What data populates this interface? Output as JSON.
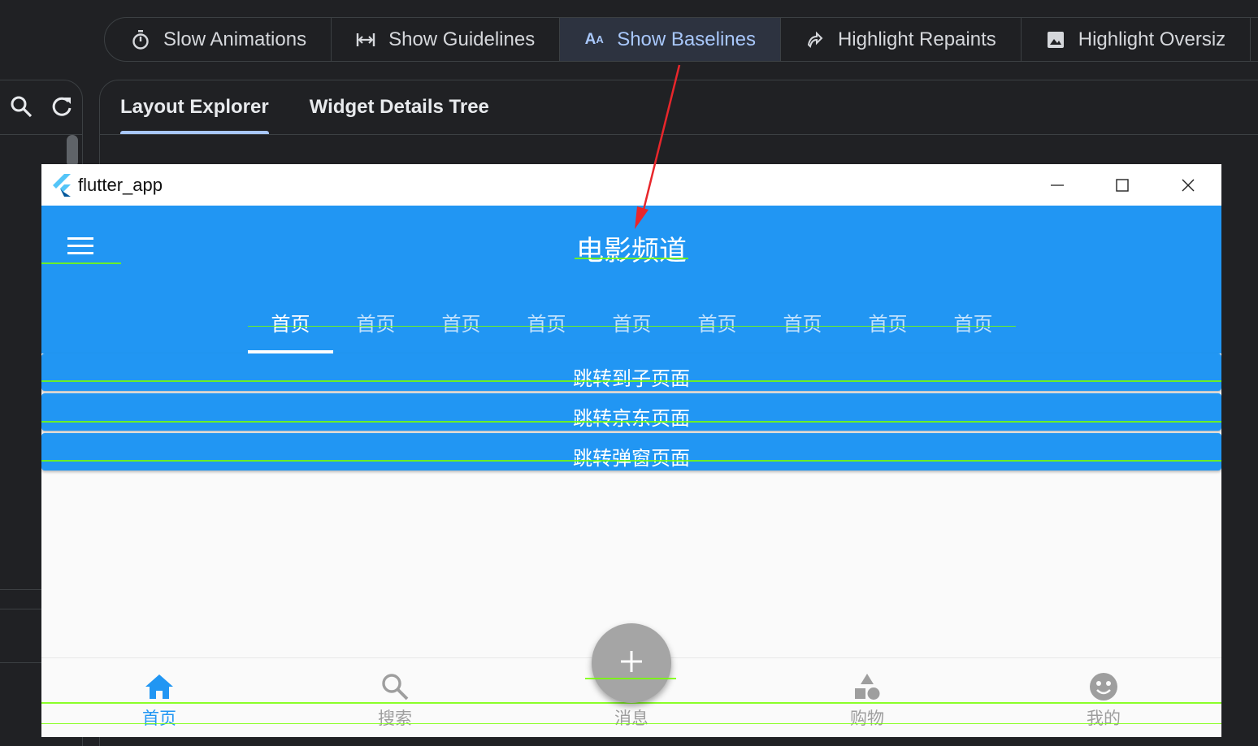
{
  "devtools": {
    "toolbar": [
      {
        "label": "Slow Animations",
        "icon": "timer-icon"
      },
      {
        "label": "Show Guidelines",
        "icon": "guidelines-icon"
      },
      {
        "label": "Show Baselines",
        "icon": "baselines-icon",
        "active": true
      },
      {
        "label": "Highlight Repaints",
        "icon": "repaint-icon"
      },
      {
        "label": "Highlight Oversiz",
        "icon": "image-icon"
      }
    ],
    "tabs": [
      {
        "label": "Layout Explorer",
        "active": true
      },
      {
        "label": "Widget Details Tree"
      }
    ],
    "colors": {
      "background": "#202124",
      "active_tab": "#a8c7fa",
      "active_button_bg": "#2d3340"
    }
  },
  "app": {
    "window_title": "flutter_app",
    "appbar_title": "电影频道",
    "tabs": [
      "首页",
      "首页",
      "首页",
      "首页",
      "首页",
      "首页",
      "首页",
      "首页",
      "首页"
    ],
    "active_tab_index": 0,
    "buttons": [
      "跳转到子页面",
      "跳转京东页面",
      "跳转弹窗页面"
    ],
    "bottom_nav": [
      {
        "label": "首页",
        "icon": "home-icon",
        "active": true
      },
      {
        "label": "搜索",
        "icon": "search-icon"
      },
      {
        "label": "消息",
        "icon": "fab-placeholder"
      },
      {
        "label": "购物",
        "icon": "category-icon"
      },
      {
        "label": "我的",
        "icon": "face-icon"
      }
    ],
    "colors": {
      "primary": "#2196f3",
      "baseline": "#76ff03",
      "fab": "#a5a5a5"
    }
  }
}
